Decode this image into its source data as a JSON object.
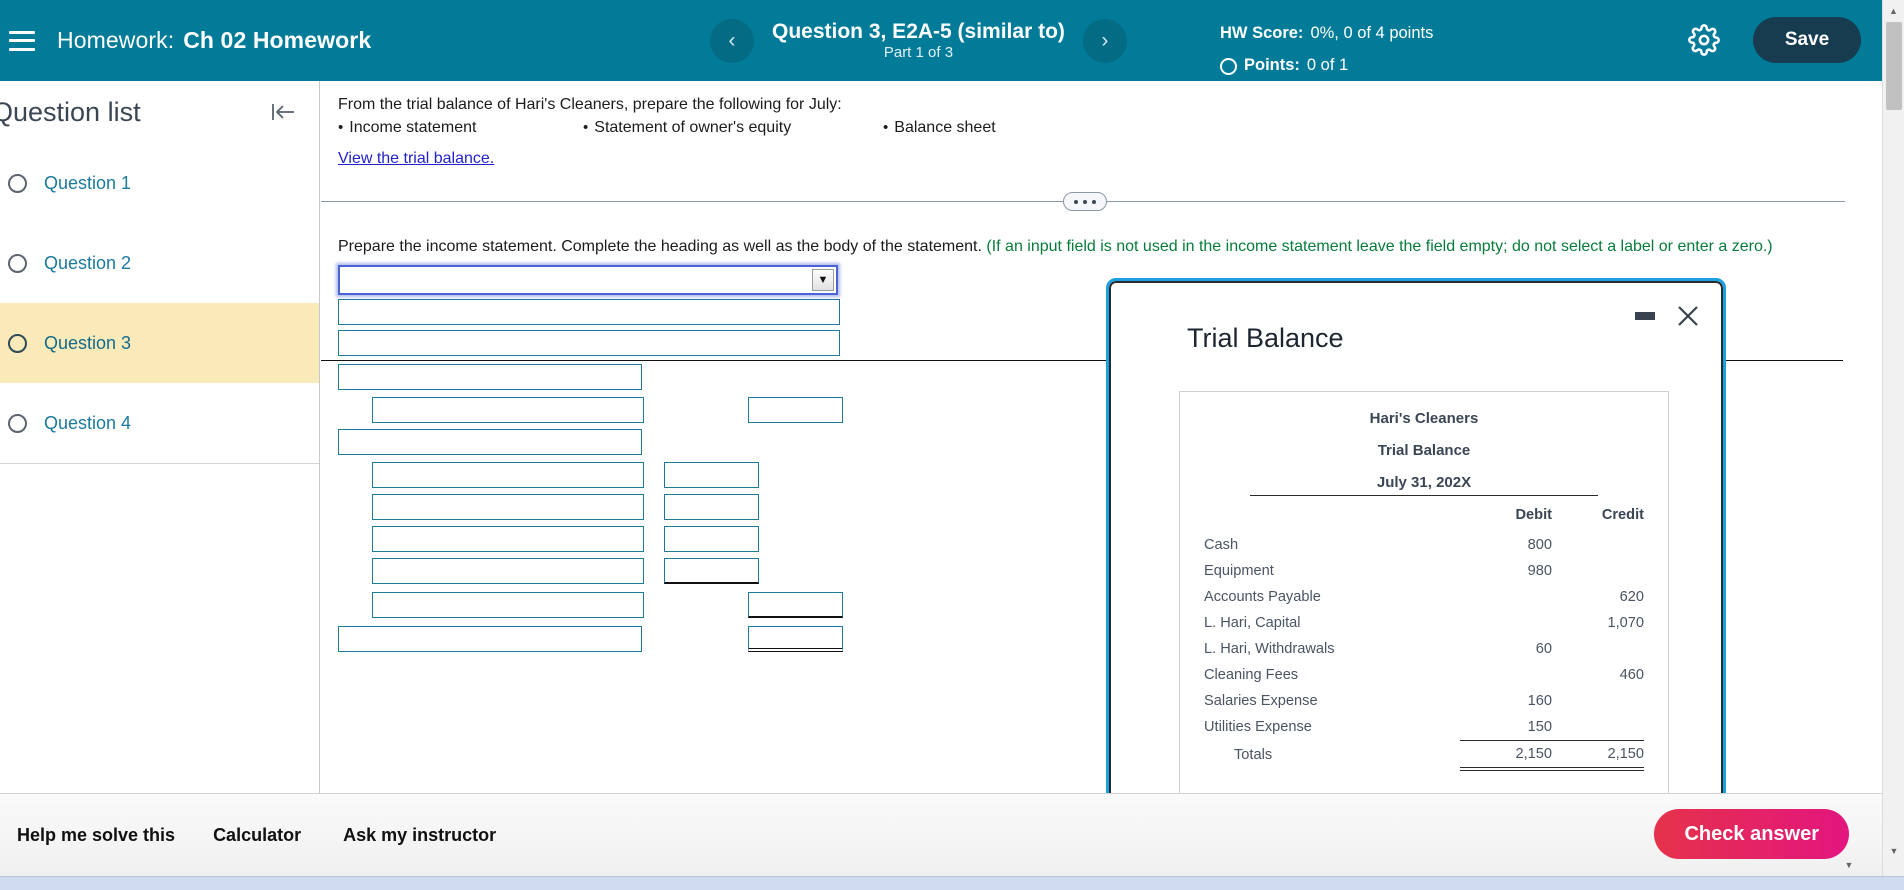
{
  "header": {
    "menu_icon": "hamburger-icon",
    "label": "Homework:",
    "course": "Ch 02 Homework",
    "prev_icon": "chevron-left-icon",
    "next_icon": "chevron-right-icon",
    "question_title": "Question 3, E2A-5 (similar to)",
    "part": "Part 1 of 3",
    "hw_score_label": "HW Score:",
    "hw_score_value": "0%, 0 of 4 points",
    "points_label": "Points:",
    "points_value": "0 of 1",
    "gear_icon": "gear-icon",
    "save_label": "Save",
    "bg_color": "#027b99",
    "save_bg_color": "#173b4f"
  },
  "sidebar": {
    "title": "Question list",
    "collapse_icon": "collapse-left-icon",
    "active_index": 2,
    "highlight_color": "#faeab9",
    "link_color": "#1b7a9e",
    "items": [
      {
        "label": "Question 1"
      },
      {
        "label": "Question 2"
      },
      {
        "label": "Question 3"
      },
      {
        "label": "Question 4"
      }
    ]
  },
  "content": {
    "prompt_line": "From the trial balance of Hari's Cleaners, prepare the following for July:",
    "bullets": [
      "Income statement",
      "Statement of owner's equity",
      "Balance sheet"
    ],
    "view_link": "View the trial balance.",
    "divider_handle_icon": "drag-dots-icon",
    "instruction": "Prepare the income statement. Complete the heading as well as the body of the statement.",
    "instruction_note": "(If an input field is not used in the income statement leave the field empty; do not select a label or enter a zero.)",
    "note_color": "#077c3b",
    "dropdown_value": "",
    "dropdown_arrow_icon": "caret-down-icon",
    "field_border_color": "#1d7a99",
    "fields": [
      {
        "name": "heading-line-1",
        "value": ""
      },
      {
        "name": "heading-line-2",
        "value": ""
      },
      {
        "name": "heading-line-3",
        "value": ""
      },
      {
        "name": "body-label-1",
        "value": ""
      },
      {
        "name": "body-label-2",
        "value": ""
      },
      {
        "name": "body-amount-2",
        "value": ""
      },
      {
        "name": "body-label-3",
        "value": ""
      },
      {
        "name": "body-label-4",
        "value": ""
      },
      {
        "name": "body-amount-4",
        "value": ""
      },
      {
        "name": "body-label-5",
        "value": ""
      },
      {
        "name": "body-amount-5",
        "value": ""
      },
      {
        "name": "body-label-6",
        "value": ""
      },
      {
        "name": "body-amount-6",
        "value": ""
      },
      {
        "name": "body-label-7",
        "value": ""
      },
      {
        "name": "body-amount-7",
        "value": ""
      },
      {
        "name": "body-label-8",
        "value": ""
      },
      {
        "name": "body-amount-8",
        "value": ""
      },
      {
        "name": "body-label-9",
        "value": ""
      },
      {
        "name": "body-amount-9",
        "value": ""
      }
    ]
  },
  "dialog": {
    "title": "Trial Balance",
    "minimize_icon": "minimize-icon",
    "close_icon": "close-icon",
    "border_color": "#1ba0e2",
    "company": "Hari's Cleaners",
    "statement": "Trial Balance",
    "date": "July 31, 202X",
    "col_debit": "Debit",
    "col_credit": "Credit",
    "rows": [
      {
        "label": "Cash",
        "debit": "800",
        "credit": ""
      },
      {
        "label": "Equipment",
        "debit": "980",
        "credit": ""
      },
      {
        "label": "Accounts Payable",
        "debit": "",
        "credit": "620"
      },
      {
        "label": "L. Hari, Capital",
        "debit": "",
        "credit": "1,070"
      },
      {
        "label": "L. Hari, Withdrawals",
        "debit": "60",
        "credit": ""
      },
      {
        "label": "Cleaning Fees",
        "debit": "",
        "credit": "460"
      },
      {
        "label": "Salaries Expense",
        "debit": "160",
        "credit": ""
      },
      {
        "label": "Utilities Expense",
        "debit": "150",
        "credit": ""
      }
    ],
    "totals_label": "Totals",
    "totals_debit": "2,150",
    "totals_credit": "2,150"
  },
  "bottombar": {
    "help_label": "Help me solve this",
    "calculator_label": "Calculator",
    "instructor_label": "Ask my instructor",
    "check_label": "Check answer",
    "check_color": "#e3157f"
  },
  "scrollbar": {
    "up_icon": "scroll-up-icon",
    "down_icon": "scroll-down-icon"
  }
}
